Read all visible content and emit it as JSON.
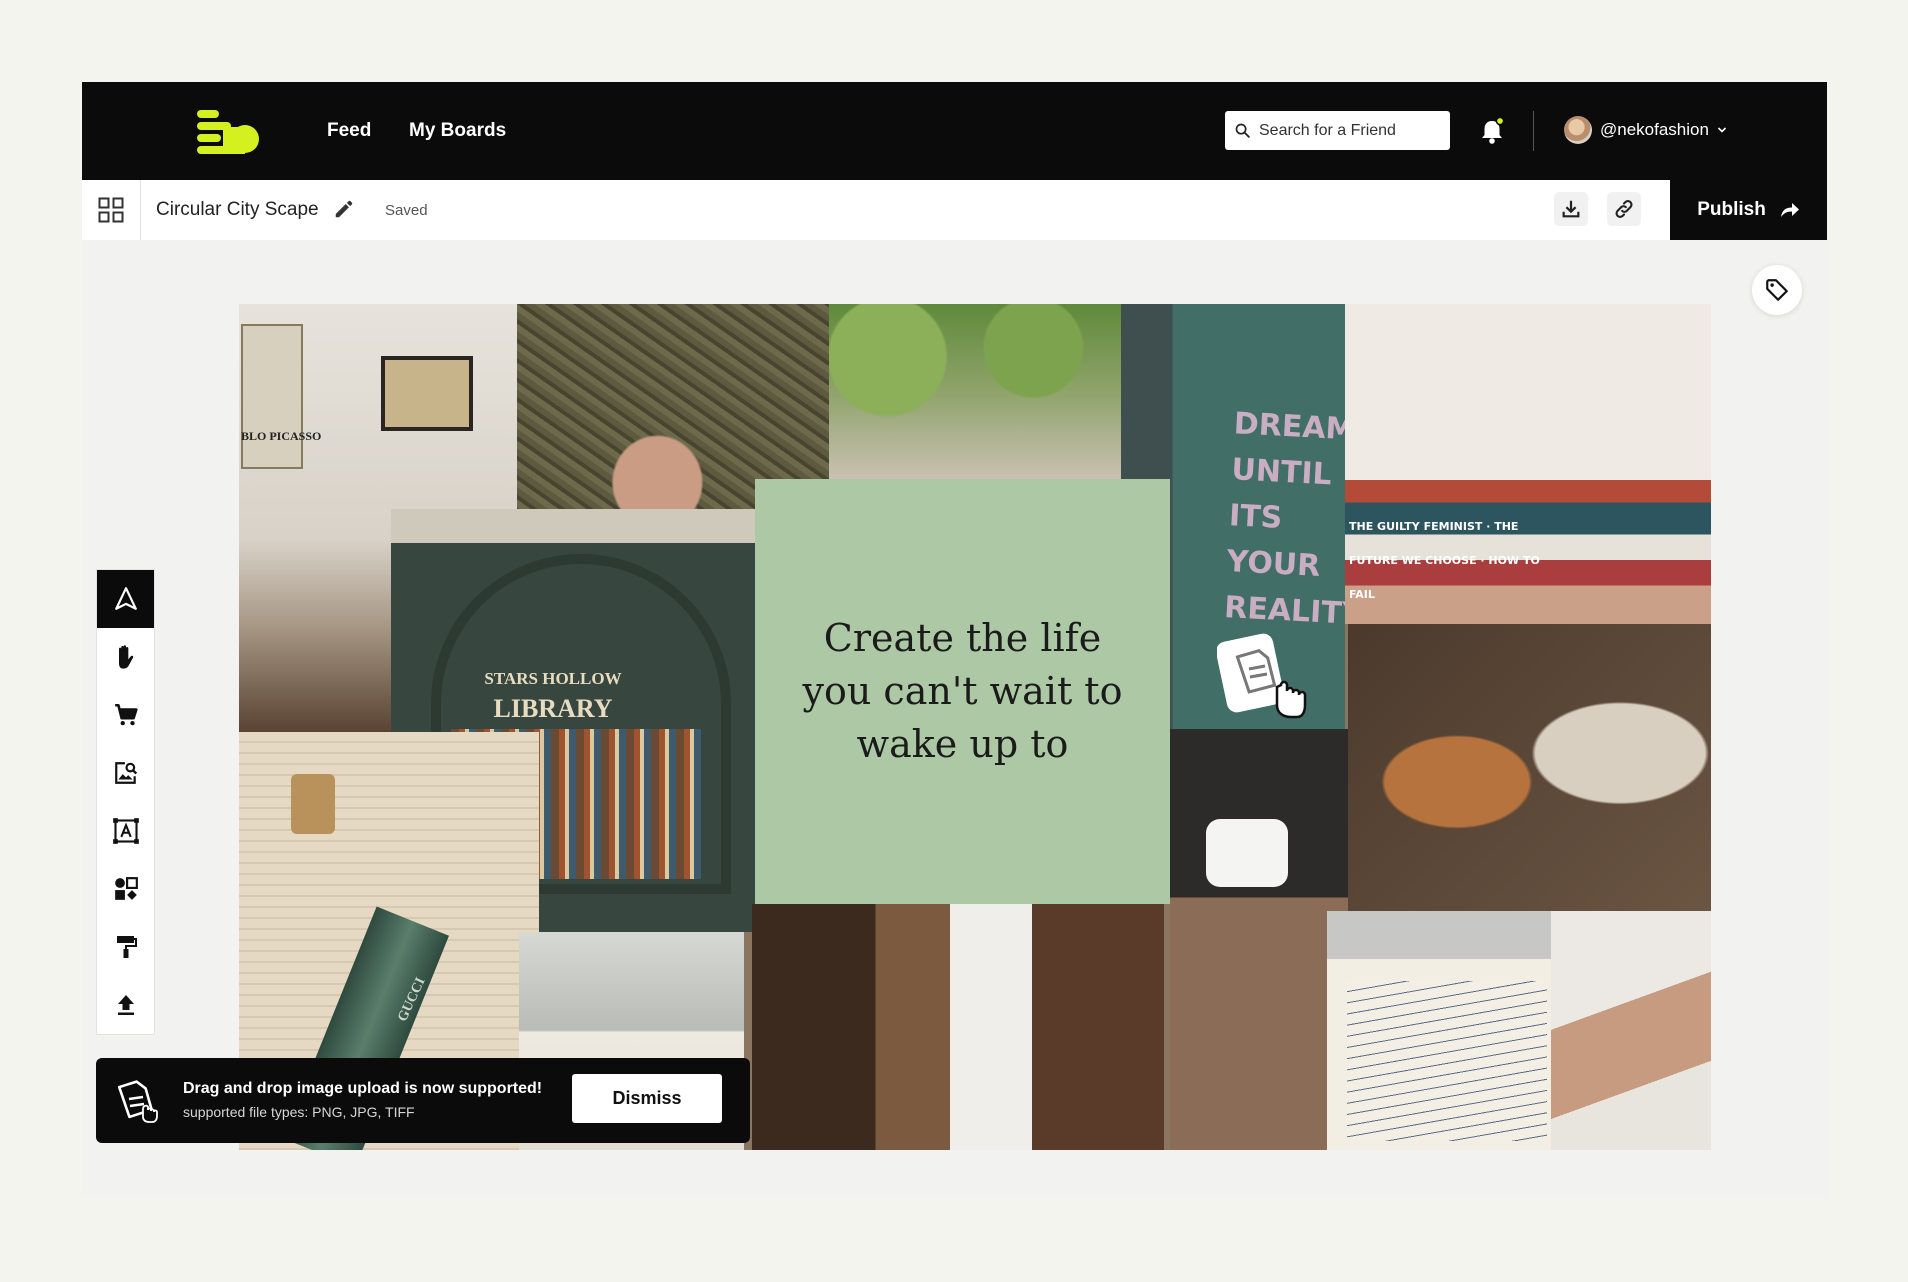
{
  "nav": {
    "feed_label": "Feed",
    "boards_label": "My Boards",
    "search_placeholder": "Search for a Friend",
    "username": "@nekofashion"
  },
  "board": {
    "title": "Circular City Scape",
    "status": "Saved",
    "publish_label": "Publish"
  },
  "canvas": {
    "quote": "Create the life you can't wait to wake up to",
    "photo_texts": {
      "picasso": "BLO PICASSO",
      "library_1": "STARS HOLLOW",
      "library_2": "LIBRARY",
      "dream": "DREAM UNTIL ITS YOUR REALITY",
      "books": "THE GUILTY FEMINIST · THE FUTURE WE CHOOSE · HOW TO FAIL",
      "gucci": "GUCCI"
    }
  },
  "toolbar": {
    "tools": [
      "cursor-icon",
      "hand-icon",
      "cart-icon",
      "image-search-icon",
      "text-frame-icon",
      "shapes-icon",
      "paint-roller-icon",
      "upload-icon"
    ]
  },
  "toast": {
    "title": "Drag and drop image upload is now supported!",
    "subtitle": "supported file types: PNG, JPG, TIFF",
    "dismiss_label": "Dismiss"
  },
  "colors": {
    "accent": "#d4f01e",
    "dark": "#0b0b0c",
    "quote_bg": "#adc8a4"
  }
}
